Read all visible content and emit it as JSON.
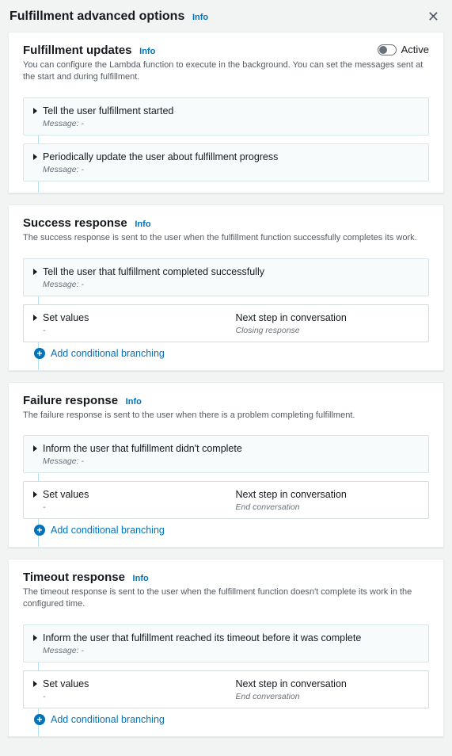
{
  "page": {
    "title": "Fulfillment advanced options",
    "info": "Info"
  },
  "updates": {
    "title": "Fulfillment updates",
    "info": "Info",
    "desc": "You can configure the Lambda function to execute in the background. You can set the messages sent at the start and during fulfillment.",
    "toggle_label": "Active",
    "card1": {
      "title": "Tell the user fulfillment started",
      "sub": "Message: -"
    },
    "card2": {
      "title": "Periodically update the user about fulfillment progress",
      "sub": "Message: -"
    }
  },
  "success": {
    "title": "Success response",
    "info": "Info",
    "desc": "The success response is sent to the user when the fulfillment function successfully completes its work.",
    "msg_card": {
      "title": "Tell the user that fulfillment completed successfully",
      "sub": "Message: -"
    },
    "values_card": {
      "left_title": "Set values",
      "left_sub": "-",
      "right_title": "Next step in conversation",
      "right_sub": "Closing response"
    },
    "add": "Add conditional branching"
  },
  "failure": {
    "title": "Failure response",
    "info": "Info",
    "desc": "The failure response is sent to the user when there is a problem completing fulfillment.",
    "msg_card": {
      "title": "Inform the user that fulfillment didn't complete",
      "sub": "Message: -"
    },
    "values_card": {
      "left_title": "Set values",
      "left_sub": "-",
      "right_title": "Next step in conversation",
      "right_sub": "End conversation"
    },
    "add": "Add conditional branching"
  },
  "timeout": {
    "title": "Timeout response",
    "info": "Info",
    "desc": "The timeout response is sent to the user when the fulfillment function doesn't complete its work in the configured time.",
    "msg_card": {
      "title": "Inform the user that fulfillment reached its timeout before it was complete",
      "sub": "Message: -"
    },
    "values_card": {
      "left_title": "Set values",
      "left_sub": "-",
      "right_title": "Next step in conversation",
      "right_sub": "End conversation"
    },
    "add": "Add conditional branching"
  }
}
